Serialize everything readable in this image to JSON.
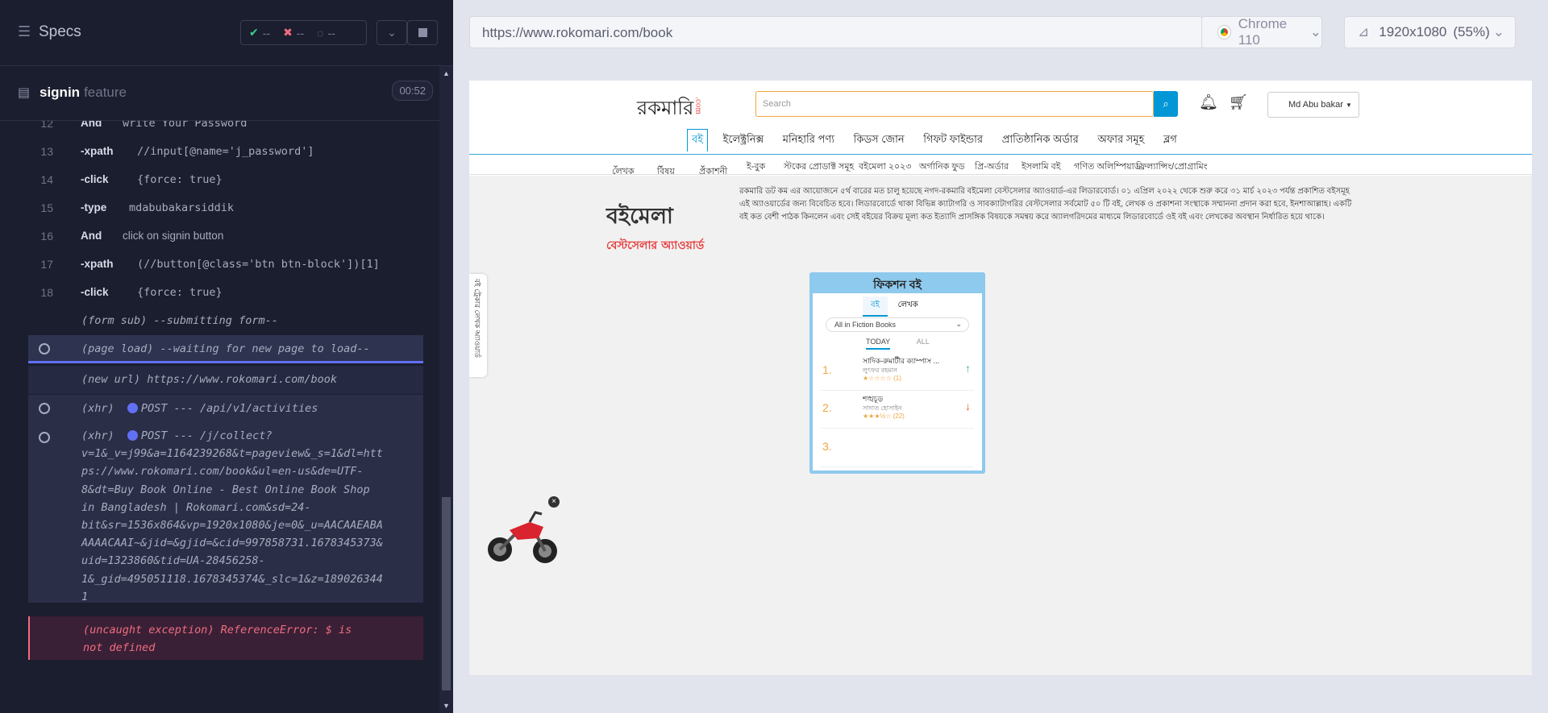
{
  "left": {
    "specs_title": "Specs",
    "stats": {
      "passed": "--",
      "failed": "--",
      "pending": "--"
    },
    "spec_name": "signin",
    "spec_type": "feature",
    "time": "00:52",
    "commands": [
      {
        "line": "12",
        "name": "And",
        "value": "write Your Password"
      },
      {
        "line": "13",
        "name": "-xpath",
        "value": "//input[@name='j_password']"
      },
      {
        "line": "14",
        "name": "-click",
        "value": "{force: true}"
      },
      {
        "line": "15",
        "name": "-type",
        "value": "mdabubakarsiddik"
      },
      {
        "line": "16",
        "name": "And",
        "value": "click on signin button"
      },
      {
        "line": "17",
        "name": "-xpath",
        "value": "(//button[@class='btn btn-block'])[1]"
      },
      {
        "line": "18",
        "name": "-click",
        "value": "{force: true}"
      }
    ],
    "form_sub": "(form sub)  --submitting form--",
    "page_load": "(page load)  --waiting for new page to load--",
    "new_url": "(new url)  https://www.rokomari.com/book",
    "xhr1_label": "(xhr)",
    "xhr1_text": "POST --- /api/v1/activities",
    "xhr2_label": "(xhr)",
    "xhr2_text": "POST --- /j/collect?",
    "xhr2_lines": [
      "v=1&_v=j99&a=1164239268&t=pageview&_s=1&dl=htt",
      "ps://www.rokomari.com/book&ul=en-us&de=UTF-",
      "8&dt=Buy Book Online - Best Online Book Shop",
      "in Bangladesh | Rokomari.com&sd=24-",
      "bit&sr=1536x864&vp=1920x1080&je=0&_u=AACAAEABA",
      "AAAACAAI~&jid=&gjid=&cid=997858731.1678345373&",
      "uid=1323860&tid=UA-28456258-",
      "1&_gid=495051118.1678345374&_slc=1&z=189026344",
      "1"
    ],
    "error_line1": "(uncaught exception)  ReferenceError: $ is",
    "error_line2": "not defined"
  },
  "right": {
    "url": "https://www.rokomari.com/book",
    "browser": "Chrome 110",
    "viewport": "1920x1080",
    "zoom": "(55%)"
  },
  "site": {
    "logo": "রকমারি",
    "logo_suffix": ".com",
    "search_placeholder": "Search",
    "user": "Md Abu bakar",
    "categories": [
      "বই",
      "ইলেক্ট্রনিক্স",
      "মনিহারি পণ্য",
      "কিডস জোন",
      "গিফট ফাইন্ডার",
      "প্রাতিষ্ঠানিক অর্ডার",
      "অফার সমূহ",
      "ব্লগ"
    ],
    "subnav": [
      "লেখক",
      "বিষয়",
      "প্রকাশনী",
      "ই-বুক",
      "স্টকের প্রোডাক্ট সমূহ",
      "বইমেলা ২০২৩",
      "অর্গানিক ফুড",
      "প্রি-অর্ডার",
      "ইসলামি বই",
      "গণিত অলিম্পিয়াড",
      "ফ্রিল্যান্সিং/প্রোগ্রামিং"
    ],
    "award_logo_1": "বইমেলা",
    "award_logo_2": "বেস্টসেলার অ্যাওয়ার্ড",
    "award_text": "রকমারি ডট কম এর আয়োজনে ৫র্থ বারের মত চালু হয়েছে নগদ-রকমারি বইমেলা বেস্টসেলার অ্যাওয়ার্ড-এর লিডারবোর্ড। ০১ এপ্রিল ২০২২ থেকে শুরু করে ৩১ মার্চ ২০২৩ পর্যন্ত প্রকাশিত বইসমূহ এই অ্যাওয়ার্ডের জন্য বিবেচিত হবে। লিডারবোর্ডে থাকা বিভিন্ন ক্যাটাগরি ও সাবক্যাটাগরির বেস্টসেলার সর্বমোট ৫০ টি বই, লেখক ও প্রকাশনা সংস্থাকে সম্মাননা প্রদান করা হবে, ইনশাআল্লাহ। একটি বই কত বেশী পাঠক কিনলেন এবং সেই বইয়ের বিক্রয় মূল্য কত ইত্যাদি প্রাসঙ্গিক বিষয়কে সমন্বয় করে অ্যালগরিদমের মাধ্যমে লিডারবোর্ডে ওই বই এবং লেখকের অবস্থান নির্ধারিত হয়ে থাকে।",
    "fiction_title": "ফিকশন বই",
    "fiction_tabs": [
      "বই",
      "লেখক"
    ],
    "fiction_select": "All in Fiction Books",
    "periods": [
      "TODAY",
      "ALL"
    ],
    "items": [
      {
        "rank": "1.",
        "title": "সাদিক-রুমার্টীর ক্যাম্পাস ...",
        "author": "লুৎফর রহমান",
        "rating": "★☆☆☆☆ (1)",
        "trend": "↑"
      },
      {
        "rank": "2.",
        "title": "শঙ্খচূড়",
        "author": "সাদাত হোসাইন",
        "rating": "★★★½☆ (22)",
        "trend": "↓"
      },
      {
        "rank": "3.",
        "title": "",
        "author": "",
        "rating": "",
        "trend": ""
      }
    ],
    "side_tab": "বই ট্রেকার লেখক অ্যাওয়ার্ড"
  },
  "colors": {
    "accent": "#6270f5",
    "error_bg": "#3a2036",
    "error_text": "#f06d80",
    "site_blue": "#0397d6",
    "site_orange": "#f0a541"
  }
}
